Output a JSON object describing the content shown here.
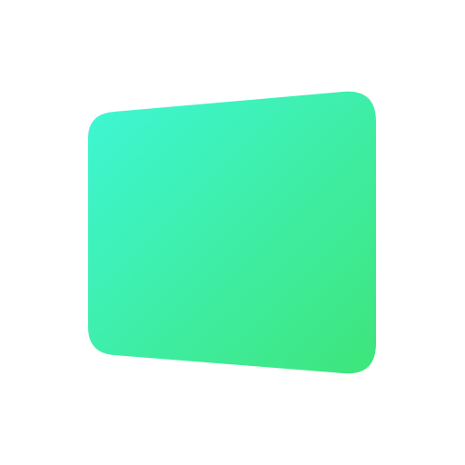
{
  "canvas": {
    "background": "#ffffff"
  },
  "shape": {
    "name": "green-rounded-panel-icon",
    "gradient": {
      "start": "#3ef7d6",
      "end": "#3ee57a"
    }
  }
}
